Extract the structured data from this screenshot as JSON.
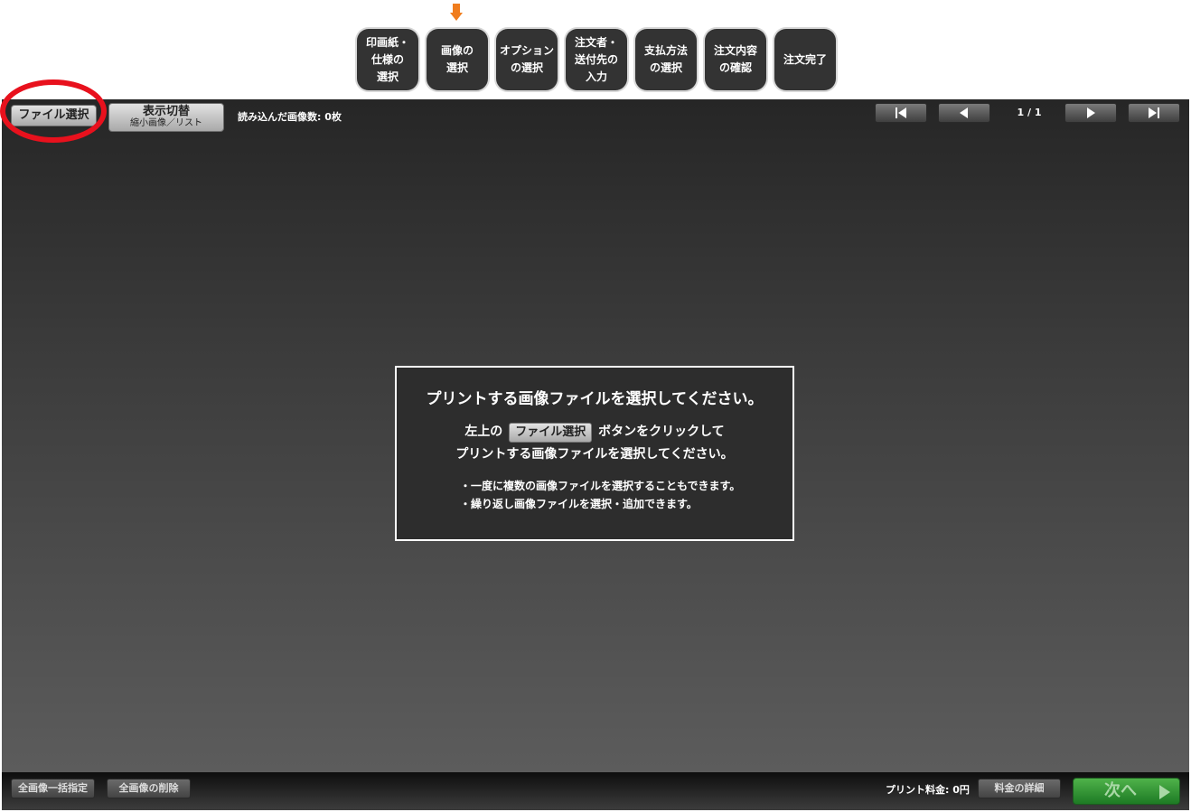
{
  "steps": [
    {
      "label": "印画紙・\n仕様の\n選択"
    },
    {
      "label": "画像の\n選択"
    },
    {
      "label": "オプション\nの選択"
    },
    {
      "label": "注文者・\n送付先の\n入力"
    },
    {
      "label": "支払方法\nの選択"
    },
    {
      "label": "注文内容\nの確認"
    },
    {
      "label": "注文完了"
    }
  ],
  "toolbar": {
    "file_select": "ファイル選択",
    "toggle_main": "表示切替",
    "toggle_sub": "縮小画像／リスト",
    "count_label": "読み込んだ画像数: ",
    "count_value": "0枚",
    "page": "1 / 1"
  },
  "info": {
    "title": "プリントする画像ファイルを選択してください。",
    "line1_before": "左上の",
    "line1_button": "ファイル選択",
    "line1_after": "ボタンをクリックして",
    "line2": "プリントする画像ファイルを選択してください。",
    "note1": "・一度に複数の画像ファイルを選択することもできます。",
    "note2": "・繰り返し画像ファイルを選択・追加できます。"
  },
  "bottom": {
    "bulk_specify": "全画像一括指定",
    "delete_all": "全画像の削除",
    "fee_label": "プリント料金: ",
    "fee_value": "0円",
    "fee_detail": "料金の詳細",
    "next": "次へ"
  },
  "colors": {
    "highlight_circle": "#e8111d",
    "next_button": "#2e8f33",
    "step_bg": "#333333",
    "current_step_marker": "#f07d1e"
  },
  "current_step_index": 1
}
